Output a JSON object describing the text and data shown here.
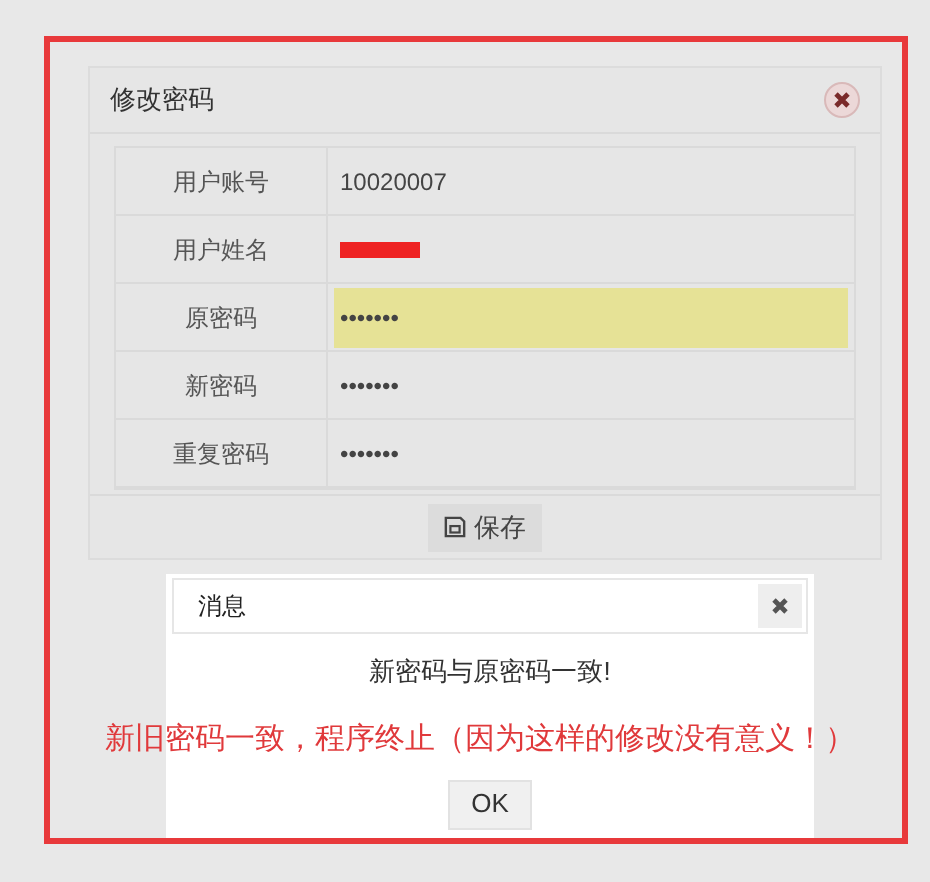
{
  "panel": {
    "title": "修改密码",
    "fields": [
      {
        "label": "用户账号",
        "value": "10020007",
        "highlighted": false
      },
      {
        "label": "用户姓名",
        "highlighted": false,
        "redacted": true
      },
      {
        "label": "原密码",
        "value": "•••••••",
        "highlighted": true
      },
      {
        "label": "新密码",
        "value": "•••••••",
        "highlighted": false
      },
      {
        "label": "重复密码",
        "value": "•••••••",
        "highlighted": false
      }
    ],
    "save_button": "保存"
  },
  "dialog": {
    "title": "消息",
    "message": "新密码与原密码一致!",
    "button": "OK"
  },
  "annotation": "新旧密码一致，程序终止（因为这样的修改没有意义！）"
}
